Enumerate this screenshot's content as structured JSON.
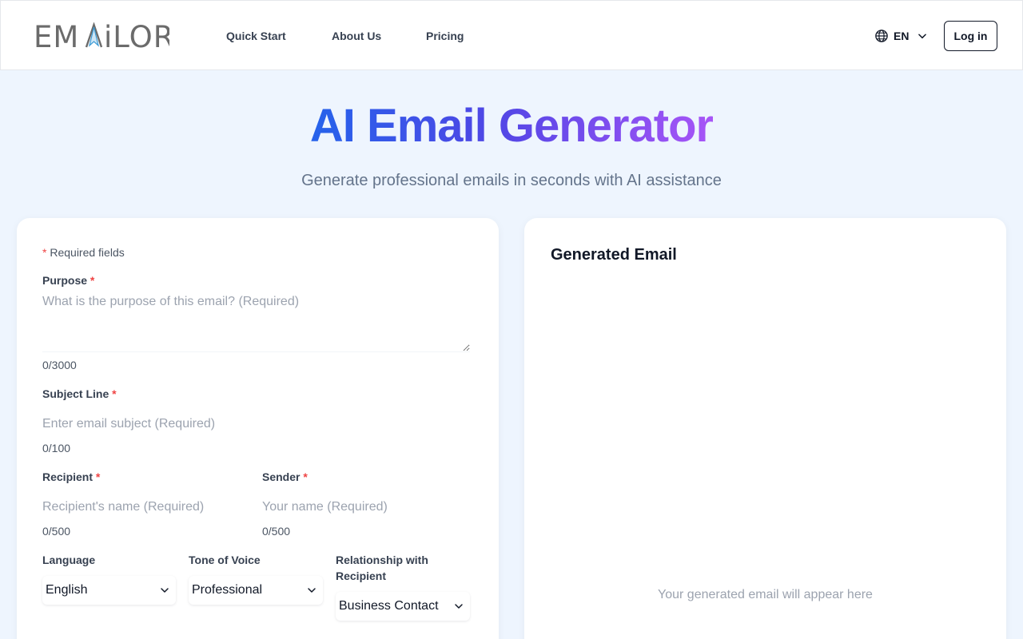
{
  "brand": {
    "logo_text": "EMAiLOR"
  },
  "nav": {
    "quick_start": "Quick Start",
    "about_us": "About Us",
    "pricing": "Pricing"
  },
  "header": {
    "language": "EN",
    "login": "Log in"
  },
  "hero": {
    "title": "AI Email Generator",
    "subtitle": "Generate professional emails in seconds with AI assistance"
  },
  "form": {
    "required_note": "Required fields",
    "required_marker": "*",
    "purpose": {
      "label": "Purpose",
      "placeholder": "What is the purpose of this email? (Required)",
      "counter": "0/3000"
    },
    "subject": {
      "label": "Subject Line",
      "placeholder": "Enter email subject (Required)",
      "counter": "0/100"
    },
    "recipient": {
      "label": "Recipient",
      "placeholder": "Recipient's name (Required)",
      "counter": "0/500"
    },
    "sender": {
      "label": "Sender",
      "placeholder": "Your name (Required)",
      "counter": "0/500"
    },
    "language": {
      "label": "Language",
      "value": "English"
    },
    "tone": {
      "label": "Tone of Voice",
      "value": "Professional"
    },
    "relationship": {
      "label_line1": "Relationship with",
      "label_line2": "Recipient",
      "value": "Business Contact"
    }
  },
  "output": {
    "title": "Generated Email",
    "placeholder": "Your generated email will appear here"
  },
  "colors": {
    "background": "#eef5fe",
    "title_gradient_start": "#2563eb",
    "title_gradient_end": "#a855f7",
    "required_star": "#ef4444"
  },
  "icons": {
    "language": "globe-icon",
    "dropdown": "chevron-down-icon"
  }
}
